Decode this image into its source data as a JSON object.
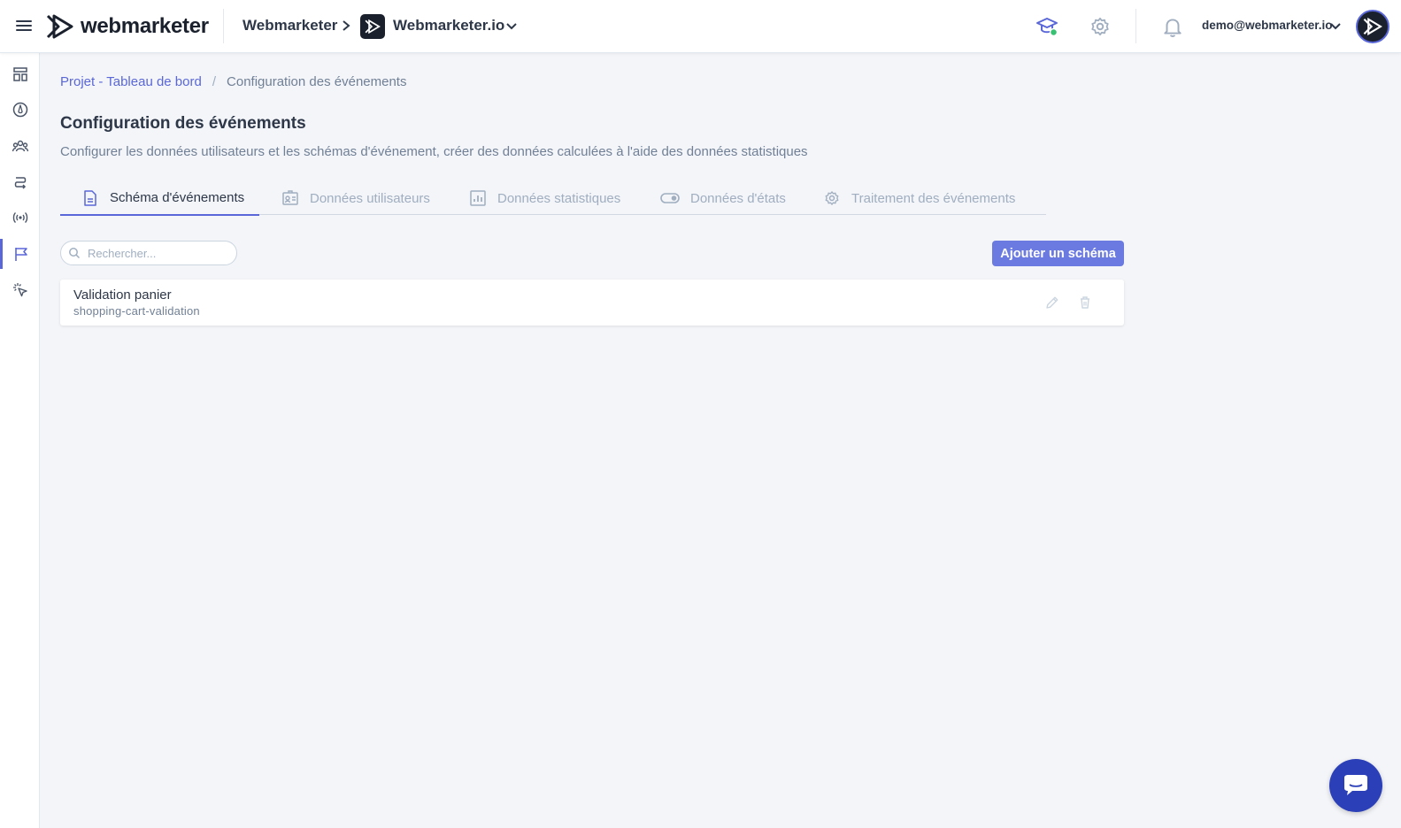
{
  "header": {
    "logo_text": "webmarketer",
    "organization": "Webmarketer",
    "project": "Webmarketer.io",
    "user_email": "demo@webmarketer.io"
  },
  "sidebar": {
    "items": [
      {
        "icon": "dashboard-icon"
      },
      {
        "icon": "gauge-icon"
      },
      {
        "icon": "users-icon"
      },
      {
        "icon": "routing-icon"
      },
      {
        "icon": "broadcast-icon"
      },
      {
        "icon": "flag-icon",
        "active": true
      },
      {
        "icon": "click-icon"
      }
    ]
  },
  "breadcrumb": {
    "link": "Projet - Tableau de bord",
    "separator": "/",
    "current": "Configuration des événements"
  },
  "page": {
    "title": "Configuration des événements",
    "subtitle": "Configurer les données utilisateurs et les schémas d'événement, créer des données calculées à l'aide des données statistiques"
  },
  "tabs": [
    {
      "label": "Schéma d'événements",
      "icon": "document-icon",
      "active": true
    },
    {
      "label": "Données utilisateurs",
      "icon": "id-card-icon"
    },
    {
      "label": "Données statistiques",
      "icon": "bar-chart-icon"
    },
    {
      "label": "Données d'états",
      "icon": "toggle-icon"
    },
    {
      "label": "Traitement des événements",
      "icon": "gear-icon"
    }
  ],
  "search": {
    "placeholder": "Rechercher...",
    "value": ""
  },
  "actions": {
    "add_schema_label": "Ajouter un schéma"
  },
  "schemas": [
    {
      "name": "Validation panier",
      "key": "shopping-cart-validation"
    }
  ],
  "colors": {
    "accent": "#5a67d8",
    "button": "#6b7ae0",
    "chat": "#2b3fb8",
    "background": "#f3f5f9"
  }
}
